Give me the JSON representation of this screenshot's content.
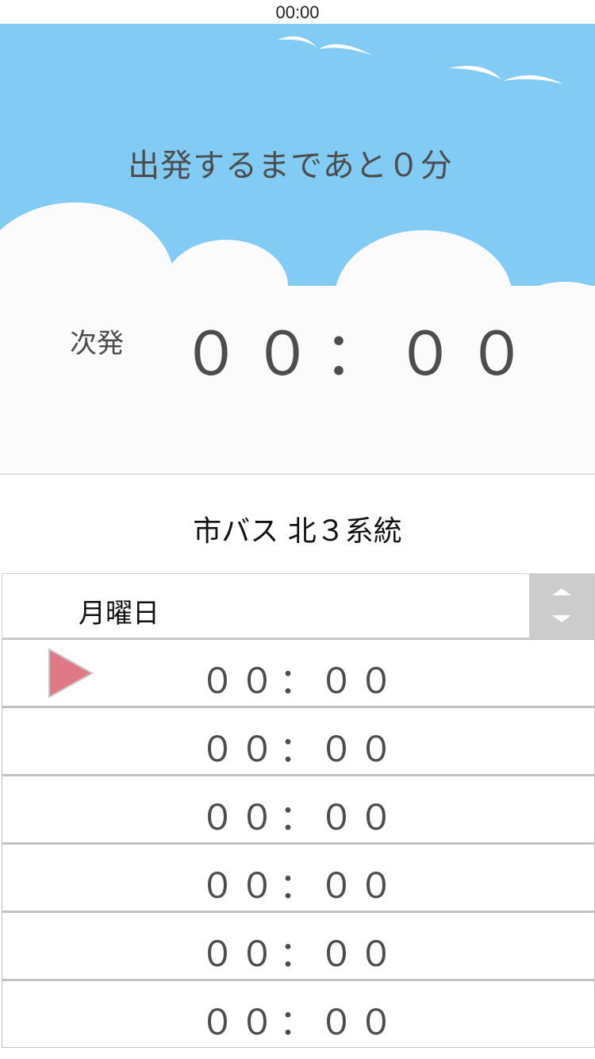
{
  "status_bar": {
    "time": "00:00"
  },
  "hero": {
    "countdown_text": "出発するまであと０分",
    "next_label": "次発",
    "next_time": "００：００",
    "colors": {
      "sky": "#82cbf5",
      "cloud": "#fbfbfb",
      "text": "#4d4d4d"
    }
  },
  "route": {
    "title": "市バス 北３系統"
  },
  "day_selector": {
    "selected": "月曜日"
  },
  "timetable": {
    "rows": [
      {
        "time": "００：００",
        "current": true
      },
      {
        "time": "００：００",
        "current": false
      },
      {
        "time": "００：００",
        "current": false
      },
      {
        "time": "００：００",
        "current": false
      },
      {
        "time": "００：００",
        "current": false
      },
      {
        "time": "００：００",
        "current": false
      }
    ],
    "marker_color": "#e07886"
  },
  "icons": {
    "current_marker": "play-triangle-icon",
    "selector_arrows": "up-down-arrows-icon",
    "birds": "bird-icon"
  }
}
